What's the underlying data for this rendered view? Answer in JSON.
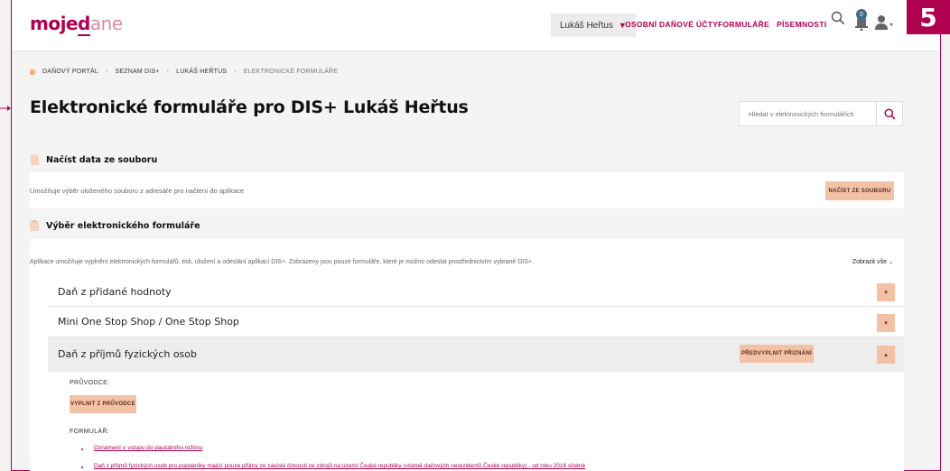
{
  "header": {
    "logo_main": "moje",
    "logo_u": "d",
    "logo_rest": "ane",
    "user_name": "Lukáš Heřtus",
    "nav": [
      "OSOBNÍ DAŇOVÉ ÚČTY",
      "FORMULÁŘE",
      "PÍSEMNOSTI"
    ],
    "notification_count": "0"
  },
  "badge": "5",
  "breadcrumb": [
    "DAŇOVÝ PORTÁL",
    "SEZNAM DIS+",
    "LUKÁŠ HEŘTUS",
    "ELEKTRONICKÉ FORMULÁŘE"
  ],
  "page_title": "Elektronické formuláře pro DIS+ Lukáš Heřtus",
  "search": {
    "placeholder": "Hledat v elektronických formulářích"
  },
  "load_section": {
    "heading": "Načíst data ze souboru",
    "description": "Umožňuje výběr uloženého souboru z adresáře pro načtení do aplikace",
    "button": "NAČÍST ZE SOUBORU"
  },
  "form_section": {
    "heading": "Výběr elektronického formuláře",
    "description": "Aplikace umožňuje vyplnění elektronických formulářů, tisk, uložení a odeslání aplikací DIS+. Zobrazeny jsou pouze formuláře, které je možno odeslat prostřednictvím vybrané DIS+.",
    "show_all": "Zobrazit vše",
    "accordion": [
      {
        "label": "Daň z přidané hodnoty"
      },
      {
        "label": "Mini One Stop Shop / One Stop Shop"
      },
      {
        "label": "Daň z příjmů fyzických osob",
        "button": "PŘEDVYPLNIT PŘIZNÁNÍ"
      }
    ],
    "guide_heading": "PRŮVODCE:",
    "guide_button": "VYPLNIT Z PRŮVODCE",
    "forms_heading": "FORMULÁŘ:",
    "forms": [
      "Oznámení o vstupu do paušálního režimu",
      "Daň z příjmů fyzických osob pro poplatníky mající pouze příjmy ze závislé činnosti ze zdrojů na území České republiky (včetně daňových nerezidentů České republiky) - od roku 2016 včetně"
    ]
  },
  "colors": {
    "brand": "#b00050",
    "accent_button": "#f3c2a6"
  }
}
